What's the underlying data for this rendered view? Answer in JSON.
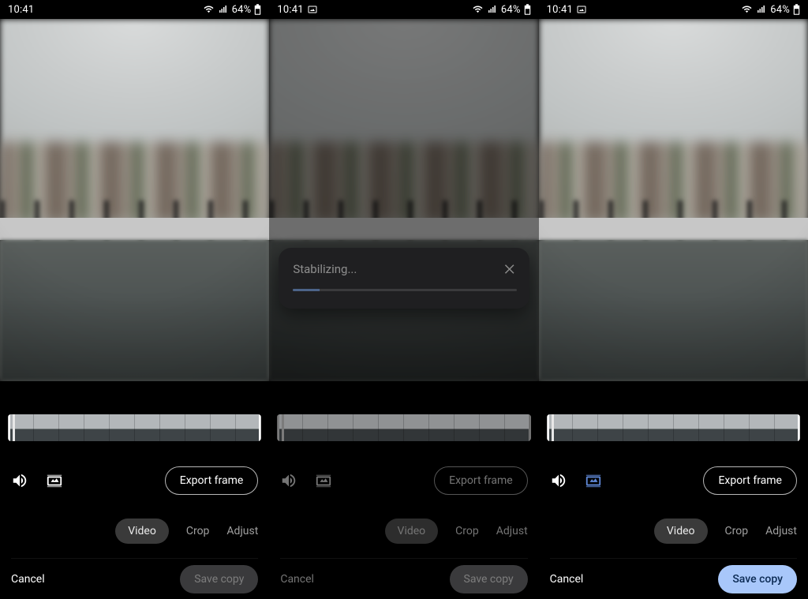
{
  "status": {
    "time": "10:41",
    "battery_text": "64%",
    "icons": {
      "photo": "landscape-icon",
      "wifi": "wifi-icon",
      "signal": "cell-signal-icon",
      "battery": "battery-icon"
    }
  },
  "export_frame": "Export frame",
  "tabs": {
    "video": "Video",
    "crop": "Crop",
    "adjust": "Adjust"
  },
  "cancel": "Cancel",
  "save_copy": "Save copy",
  "dialog": {
    "title": "Stabilizing...",
    "progress_pct": 12
  },
  "screens": [
    {
      "status_photo_icon": false,
      "preview_dimmed": false,
      "timeline_enabled": true,
      "stabilize_selected": false,
      "export_enabled": true,
      "controls_muted": false,
      "show_dialog": false,
      "save_state": "disabled"
    },
    {
      "status_photo_icon": true,
      "preview_dimmed": true,
      "timeline_enabled": false,
      "stabilize_selected": false,
      "export_enabled": false,
      "controls_muted": true,
      "show_dialog": true,
      "save_state": "disabled"
    },
    {
      "status_photo_icon": true,
      "preview_dimmed": false,
      "timeline_enabled": true,
      "stabilize_selected": true,
      "export_enabled": true,
      "controls_muted": false,
      "show_dialog": false,
      "save_state": "accent"
    }
  ]
}
